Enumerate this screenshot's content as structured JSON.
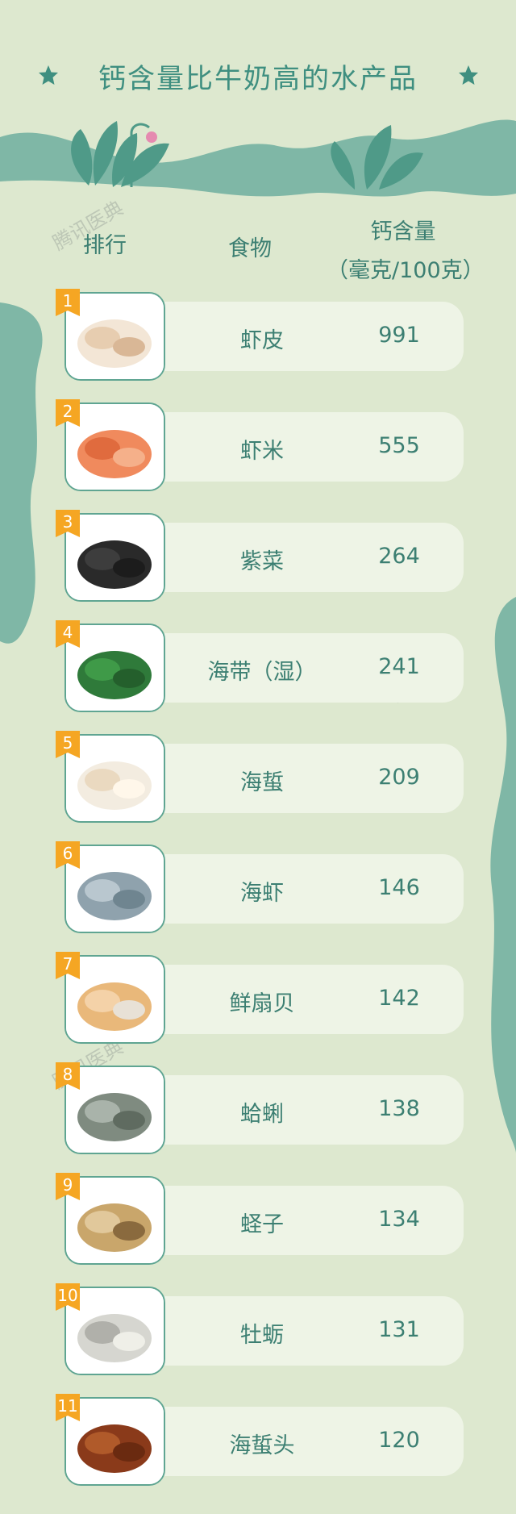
{
  "title": "钙含量比牛奶高的水产品",
  "header": {
    "rank_label": "排行",
    "food_label": "食物",
    "calcium_label": "钙含量",
    "unit_label": "（毫克/100克）"
  },
  "watermark": "腾讯医典",
  "colors": {
    "background": "#dde8cf",
    "accent_teal": "#3f8f80",
    "side_wave": "#7fb7a6",
    "pill": "#eef4e6",
    "rank_flag": "#f5a623"
  },
  "chart_data": {
    "type": "table",
    "title": "钙含量比牛奶高的水产品",
    "columns": [
      "排行",
      "食物",
      "钙含量（毫克/100克）"
    ],
    "rows": [
      {
        "rank": "1",
        "food": "虾皮",
        "value": "991",
        "icon": "dried-shrimp-skin-photo"
      },
      {
        "rank": "2",
        "food": "虾米",
        "value": "555",
        "icon": "dried-shrimp-photo"
      },
      {
        "rank": "3",
        "food": "紫菜",
        "value": "264",
        "icon": "laver-photo"
      },
      {
        "rank": "4",
        "food": "海带（湿）",
        "value": "241",
        "icon": "kelp-photo"
      },
      {
        "rank": "5",
        "food": "海蜇",
        "value": "209",
        "icon": "jellyfish-photo"
      },
      {
        "rank": "6",
        "food": "海虾",
        "value": "146",
        "icon": "prawn-photo"
      },
      {
        "rank": "7",
        "food": "鲜扇贝",
        "value": "142",
        "icon": "scallop-photo"
      },
      {
        "rank": "8",
        "food": "蛤蜊",
        "value": "138",
        "icon": "clam-photo"
      },
      {
        "rank": "9",
        "food": "蛏子",
        "value": "134",
        "icon": "razor-clam-photo"
      },
      {
        "rank": "10",
        "food": "牡蛎",
        "value": "131",
        "icon": "oyster-photo"
      },
      {
        "rank": "11",
        "food": "海蜇头",
        "value": "120",
        "icon": "jellyfish-head-photo"
      }
    ]
  }
}
